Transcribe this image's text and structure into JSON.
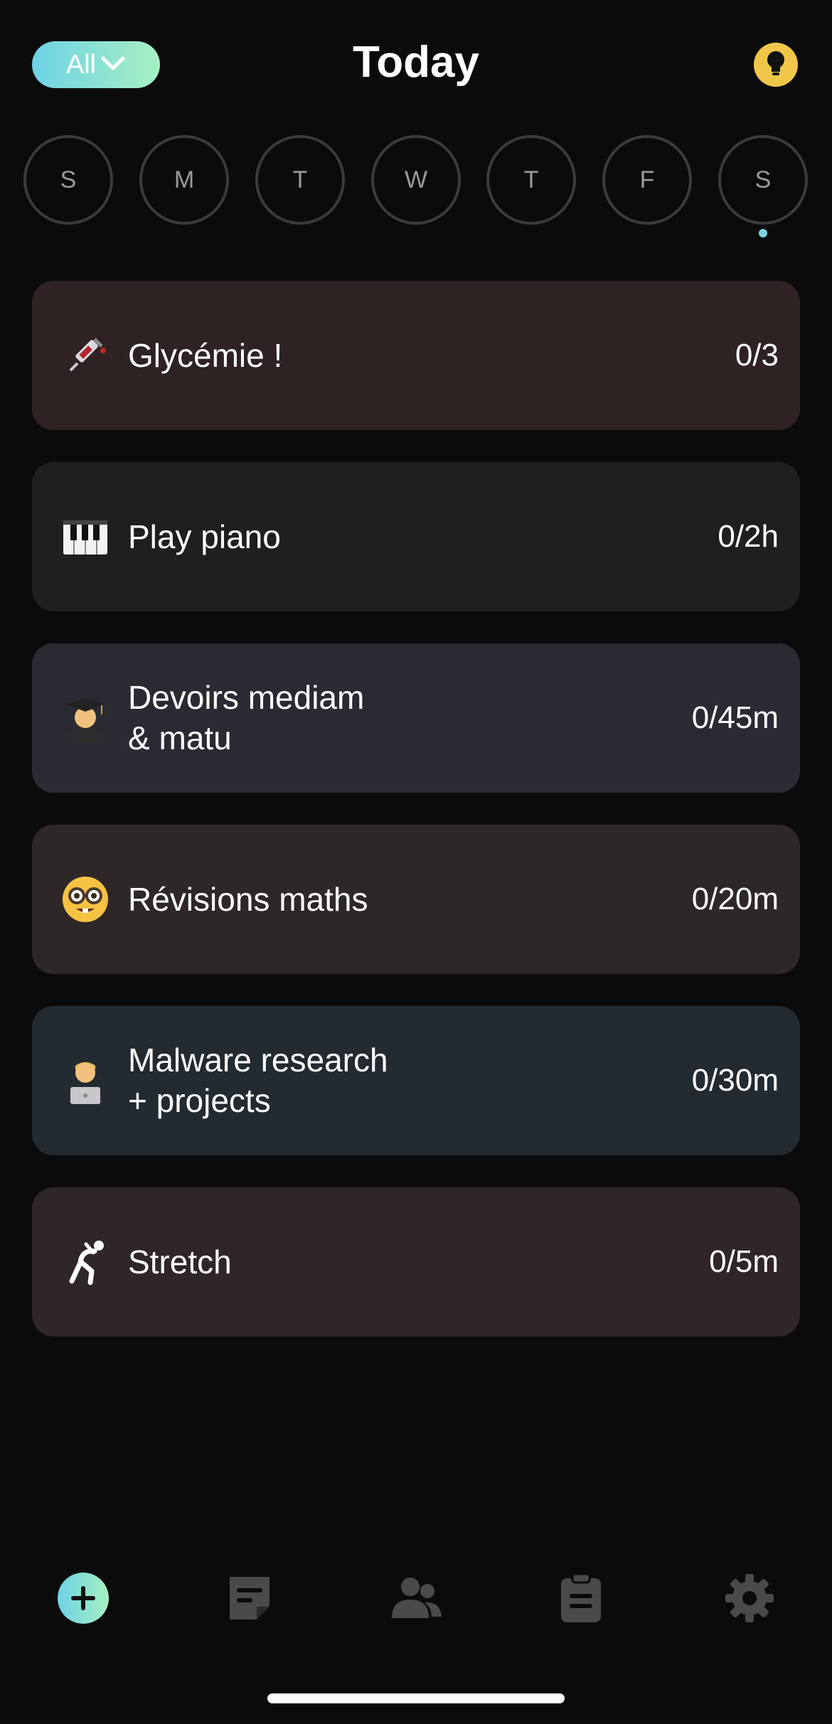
{
  "header": {
    "filter_label": "All",
    "title": "Today",
    "tip_icon": "lightbulb-icon"
  },
  "week": {
    "days": [
      "S",
      "M",
      "T",
      "W",
      "T",
      "F",
      "S"
    ],
    "selected_index": 6
  },
  "habits": [
    {
      "emoji": "syringe-icon",
      "name": "Glycémie !",
      "progress": "0/3",
      "color": "#2f2222"
    },
    {
      "emoji": "piano-keys-icon",
      "name": "Play piano",
      "progress": "0/2h",
      "color": "#1f1f1f"
    },
    {
      "emoji": "student-icon",
      "name_line1": "Devoirs mediam",
      "name_line2": "& matu",
      "progress": "0/45m",
      "color": "#2a2a33"
    },
    {
      "emoji": "nerd-face-icon",
      "name": "Révisions maths",
      "progress": "0/20m",
      "color": "#2e2728"
    },
    {
      "emoji": "technologist-icon",
      "name_line1": "Malware research",
      "name_line2": "+ projects",
      "progress": "0/30m",
      "color": "#232a30"
    },
    {
      "emoji": "stretch-icon",
      "name": "Stretch",
      "progress": "0/5m",
      "color": "#2f2628"
    }
  ],
  "colors": {
    "background": "#0b0b0b",
    "accent_gradient_start": "#6ed3e6",
    "accent_gradient_end": "#a6f0c2",
    "tip_yellow": "#f0c64a",
    "nav_icon": "#4a4a4a"
  },
  "bottom_nav": {
    "items": [
      "add-habit-icon",
      "journal-icon",
      "friends-icon",
      "clipboard-icon",
      "settings-gear-icon"
    ]
  }
}
